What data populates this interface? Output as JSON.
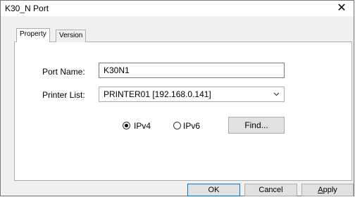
{
  "window": {
    "title": "K30_N Port",
    "close_glyph": "✕"
  },
  "tabs": [
    {
      "label": "Property",
      "selected": true
    },
    {
      "label": "Version",
      "selected": false
    }
  ],
  "form": {
    "port_name_label": "Port Name:",
    "port_name_value": "K30N1",
    "printer_list_label": "Printer List:",
    "printer_list_value": "PRINTER01 [192.168.0.141]",
    "ip_options": [
      {
        "label": "IPv4",
        "checked": true
      },
      {
        "label": "IPv6",
        "checked": false
      }
    ],
    "find_label": "Find..."
  },
  "footer": {
    "ok_label": "OK",
    "cancel_label": "Cancel",
    "apply_label": "Apply"
  },
  "colors": {
    "accent": "#0078d7",
    "button_face": "#e1e1e1",
    "panel_bg": "#ffffff",
    "dialog_bg": "#f0f0f0"
  },
  "icons": {
    "close": "close-icon",
    "dropdown": "chevron-down-icon"
  }
}
